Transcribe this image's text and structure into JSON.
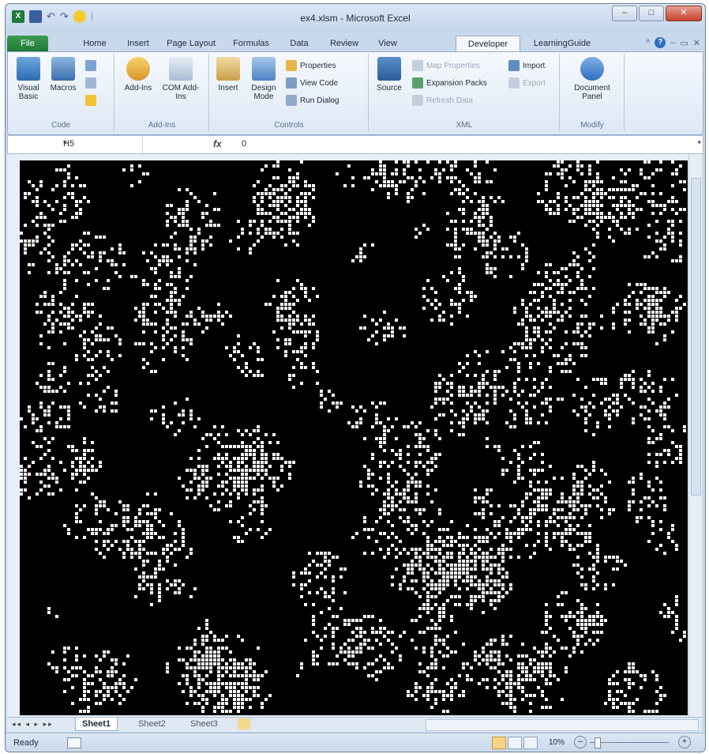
{
  "window": {
    "title": "ex4.xlsm - Microsoft Excel",
    "buttons": {
      "minimize": "–",
      "maximize": "□",
      "close": "✕"
    }
  },
  "qat": {
    "app_icon": "X",
    "separator": "|",
    "undo": "↶",
    "redo": "↷"
  },
  "tabs": [
    "File",
    "Home",
    "Insert",
    "Page Layout",
    "Formulas",
    "Data",
    "Review",
    "View",
    "Developer",
    "LearningGuide"
  ],
  "tabs_active": "Developer",
  "tab_icons": {
    "caret": "^",
    "help": "?",
    "minimize": "–",
    "restore": "▭",
    "close": "✕"
  },
  "ribbon": {
    "code": {
      "label": "Code",
      "visual_basic": "Visual Basic",
      "macros": "Macros"
    },
    "addins": {
      "label": "Add-Ins",
      "addins": "Add-Ins",
      "com_addins": "COM Add-Ins"
    },
    "controls": {
      "label": "Controls",
      "insert": "Insert",
      "design_mode": "Design Mode",
      "properties": "Properties",
      "view_code": "View Code",
      "run_dialog": "Run Dialog"
    },
    "xml": {
      "label": "XML",
      "source": "Source",
      "map_properties": "Map Properties",
      "expansion_packs": "Expansion Packs",
      "refresh_data": "Refresh Data",
      "import": "Import",
      "export": "Export"
    },
    "modify": {
      "label": "Modify",
      "document_panel": "Document Panel"
    }
  },
  "formula_bar": {
    "name_box": "H5",
    "fx": "fx",
    "value": "0",
    "dropdown": "▾",
    "expand": "▾"
  },
  "sheet_tabs": {
    "nav": "◂◂ ◂ ▸ ▸▸",
    "sheets": [
      "Sheet1",
      "Sheet2",
      "Sheet3"
    ],
    "active": "Sheet1"
  },
  "status": {
    "ready": "Ready",
    "zoom": "10%",
    "zoom_minus": "–",
    "zoom_plus": "+"
  }
}
